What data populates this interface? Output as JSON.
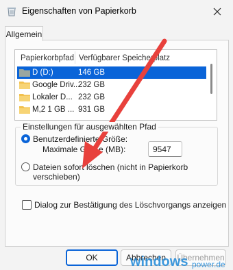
{
  "window": {
    "title": "Eigenschaften von Papierkorb",
    "close_icon": "close-icon"
  },
  "tabs": [
    {
      "label": "Allgemein",
      "active": true
    }
  ],
  "list": {
    "columns": [
      "Papierkorbpfad",
      "Verfügbarer Speicherplatz"
    ],
    "rows": [
      {
        "name": "D (D:)",
        "space": "146 GB",
        "selected": true
      },
      {
        "name": "Google Driv...",
        "space": "232 GB",
        "selected": false
      },
      {
        "name": "Lokaler D...",
        "space": "232 GB",
        "selected": false
      },
      {
        "name": "M,2 1 GB ...",
        "space": "931 GB",
        "selected": false
      }
    ]
  },
  "settings": {
    "group_label": "Einstellungen für ausgewählten Pfad",
    "custom_size_label": "Benutzerdefinierte Größe:",
    "custom_size_checked": true,
    "max_size_label": "Maximale Größe (MB):",
    "max_size_value": "9547",
    "delete_immediately_line1": "Dateien sofort löschen (nicht in Papierkorb",
    "delete_immediately_line2": "verschieben)",
    "delete_immediately_checked": false
  },
  "confirm_dialog": {
    "label": "Dialog zur Bestätigung des Löschvorgangs anzeigen",
    "checked": false
  },
  "buttons": {
    "ok": "OK",
    "cancel": "Abbrechen",
    "apply": "Übernehmen"
  },
  "watermark": {
    "text": "windowspower.de"
  },
  "colors": {
    "accent": "#0a64d8",
    "arrow": "#e8413c"
  }
}
